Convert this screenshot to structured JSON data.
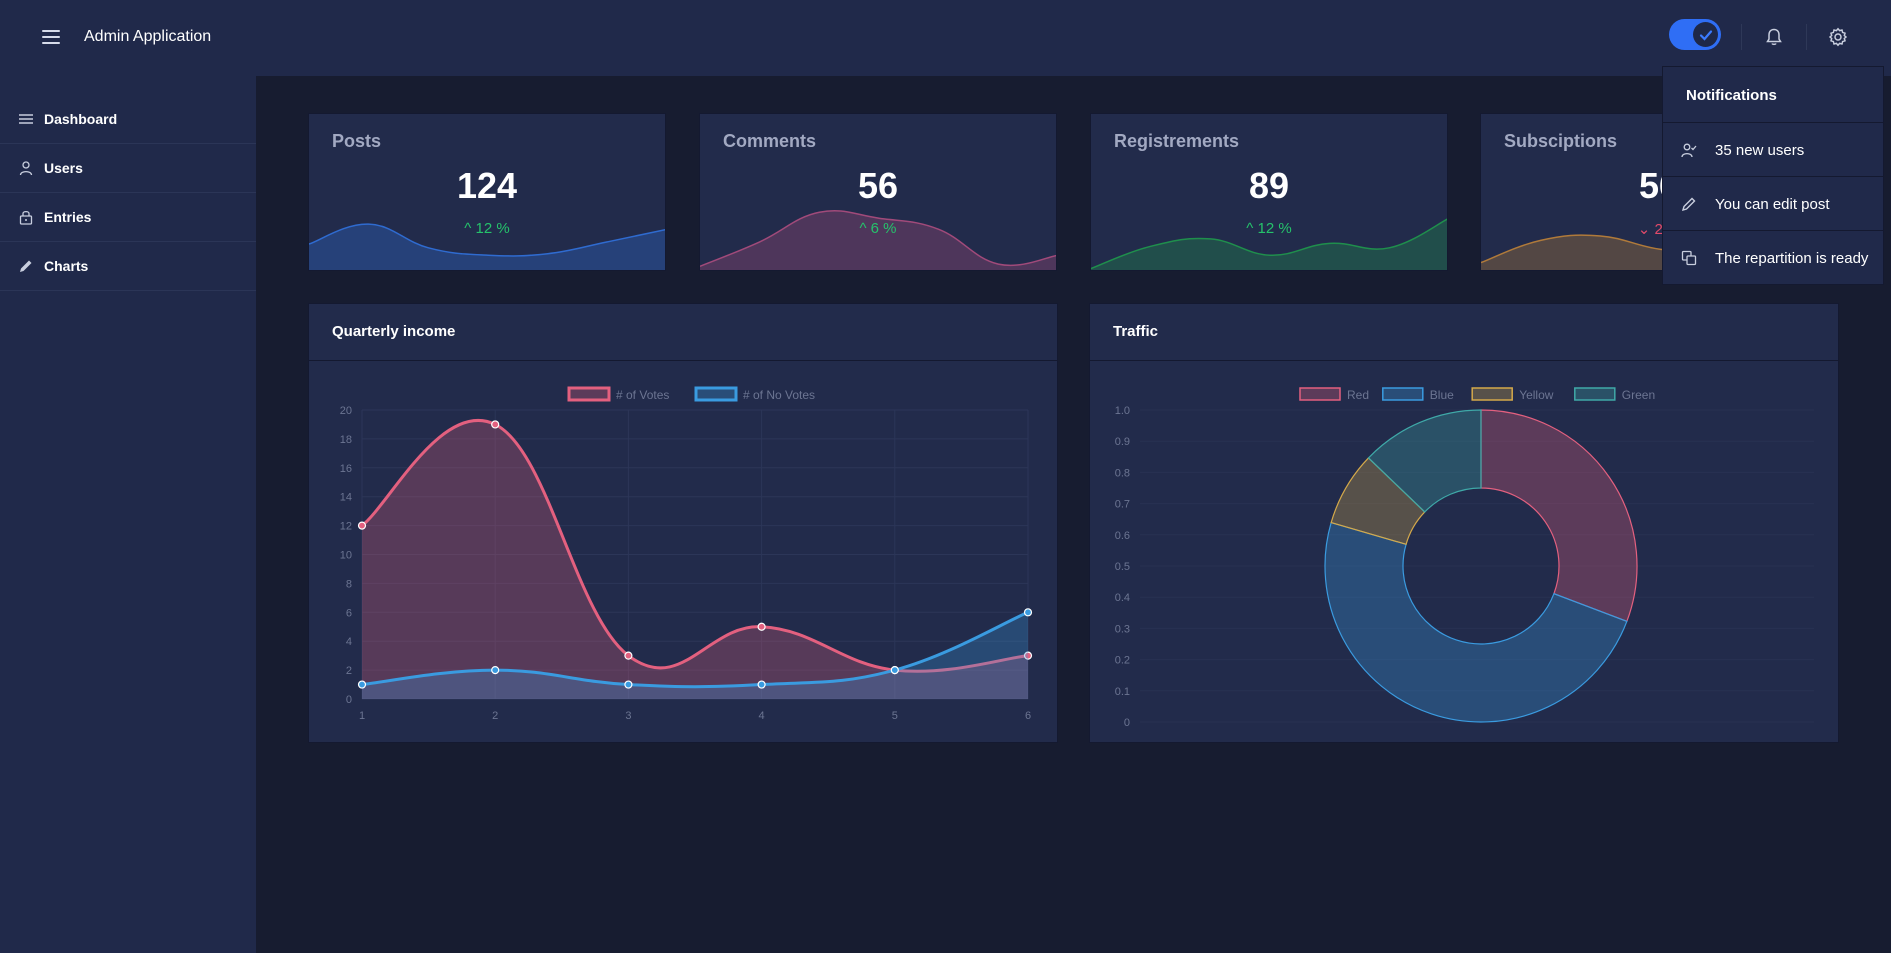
{
  "header": {
    "title": "Admin Application"
  },
  "sidebar": {
    "items": [
      {
        "label": "Dashboard",
        "icon": "list-icon"
      },
      {
        "label": "Users",
        "icon": "user-icon"
      },
      {
        "label": "Entries",
        "icon": "lock-icon"
      },
      {
        "label": "Charts",
        "icon": "pencil-icon"
      }
    ]
  },
  "stats": [
    {
      "title": "Posts",
      "value": "124",
      "trend": "12 %",
      "direction": "up",
      "color": "#2f6bd0",
      "wave": [
        0.35,
        0.62,
        0.3,
        0.2,
        0.22,
        0.38,
        0.55
      ]
    },
    {
      "title": "Comments",
      "value": "56",
      "trend": "6 %",
      "direction": "up",
      "color": "#a14a7a",
      "wave": [
        0.05,
        0.38,
        0.78,
        0.7,
        0.55,
        0.08,
        0.2
      ]
    },
    {
      "title": "Registrements",
      "value": "89",
      "trend": "12 %",
      "direction": "up",
      "color": "#1f8f4c",
      "wave": [
        0.02,
        0.32,
        0.42,
        0.2,
        0.36,
        0.3,
        0.7
      ]
    },
    {
      "title": "Subsciptions",
      "value": "56",
      "trend": "2 %",
      "direction": "down",
      "color": "#b07a3a",
      "wave": [
        0.1,
        0.4,
        0.46,
        0.28,
        0.24,
        0.3,
        0.32
      ]
    }
  ],
  "colors": {
    "up": "#25c26b",
    "down": "#e24a6a"
  },
  "line_panel": {
    "title": "Quarterly income"
  },
  "donut_panel": {
    "title": "Traffic"
  },
  "notifications": {
    "title": "Notifications",
    "items": [
      {
        "label": "35 new users",
        "icon": "user-check-icon"
      },
      {
        "label": "You can edit post",
        "icon": "pencil-icon"
      },
      {
        "label": "The repartition is ready",
        "icon": "copy-icon"
      }
    ]
  },
  "chart_data": [
    {
      "type": "line",
      "x": [
        1,
        2,
        3,
        4,
        5,
        6
      ],
      "series": [
        {
          "name": "# of Votes",
          "values": [
            12,
            19,
            3,
            5,
            2,
            3
          ],
          "color": "#e3607f"
        },
        {
          "name": "# of No Votes",
          "values": [
            1,
            2,
            1,
            1,
            2,
            6
          ],
          "color": "#3a9be0"
        }
      ],
      "ylim": [
        0,
        20
      ],
      "yticks": [
        0,
        2,
        4,
        6,
        8,
        10,
        12,
        14,
        16,
        18,
        20
      ],
      "grid": true,
      "legend": "top"
    },
    {
      "type": "pie",
      "variant": "doughnut",
      "categories": [
        "Red",
        "Blue",
        "Yellow",
        "Green"
      ],
      "values": [
        12,
        19,
        3,
        5
      ],
      "colors": [
        "#e3607f",
        "#3a9be0",
        "#d4a94a",
        "#3fa9a8"
      ],
      "yticks": [
        "0",
        "0.1",
        "0.2",
        "0.3",
        "0.4",
        "0.5",
        "0.6",
        "0.7",
        "0.8",
        "0.9",
        "1.0"
      ],
      "legend": "top"
    }
  ]
}
